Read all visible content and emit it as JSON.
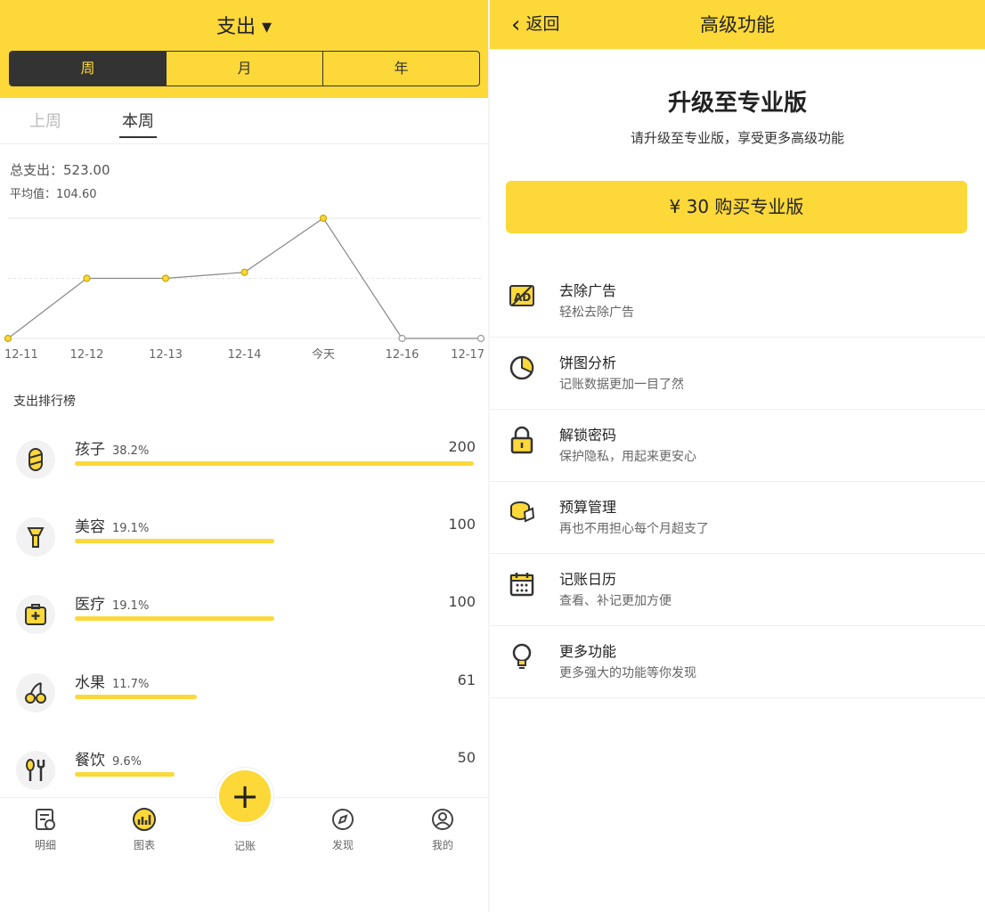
{
  "left": {
    "header": {
      "title": "支出 ▾"
    },
    "segments": [
      "周",
      "月",
      "年"
    ],
    "subtabs": [
      "上周",
      "本周"
    ],
    "summary": {
      "total": "总支出：523.00",
      "avg": "平均值：104.60"
    },
    "chart_data": {
      "type": "line",
      "categories": [
        "12-11",
        "12-12",
        "12-13",
        "12-14",
        "今天",
        "12-16",
        "12-17"
      ],
      "values": [
        0,
        100,
        100,
        110,
        200,
        0,
        0
      ],
      "ylim": [
        0,
        200
      ],
      "grid": true
    },
    "ranking_label": "支出排行榜",
    "ranking": [
      {
        "name": "孩子",
        "pct": "38.2%",
        "amount": "200",
        "frac": 1.0,
        "icon": "pacifier-icon"
      },
      {
        "name": "美容",
        "pct": "19.1%",
        "amount": "100",
        "frac": 0.5,
        "icon": "lipstick-icon"
      },
      {
        "name": "医疗",
        "pct": "19.1%",
        "amount": "100",
        "frac": 0.5,
        "icon": "medkit-icon"
      },
      {
        "name": "水果",
        "pct": "11.7%",
        "amount": "61",
        "frac": 0.305,
        "icon": "cherry-icon"
      },
      {
        "name": "餐饮",
        "pct": "9.6%",
        "amount": "50",
        "frac": 0.25,
        "icon": "utensils-icon"
      }
    ],
    "nav": [
      "明细",
      "图表",
      "记账",
      "发现",
      "我的"
    ]
  },
  "right": {
    "header": {
      "back": "返回",
      "title": "高级功能"
    },
    "pro_title": "升级至专业版",
    "pro_subtitle": "请升级至专业版，享受更多高级功能",
    "buy_button": "¥ 30 购买专业版",
    "features": [
      {
        "title": "去除广告",
        "desc": "轻松去除广告",
        "icon": "no-ads-icon"
      },
      {
        "title": "饼图分析",
        "desc": "记账数据更加一目了然",
        "icon": "pie-chart-icon"
      },
      {
        "title": "解锁密码",
        "desc": "保护隐私，用起来更安心",
        "icon": "lock-icon"
      },
      {
        "title": "预算管理",
        "desc": "再也不用担心每个月超支了",
        "icon": "budget-icon"
      },
      {
        "title": "记账日历",
        "desc": "查看、补记更加方便",
        "icon": "calendar-icon"
      },
      {
        "title": "更多功能",
        "desc": "更多强大的功能等你发现",
        "icon": "lightbulb-icon"
      }
    ]
  },
  "colors": {
    "accent": "#fcd839",
    "dark": "#333333"
  }
}
